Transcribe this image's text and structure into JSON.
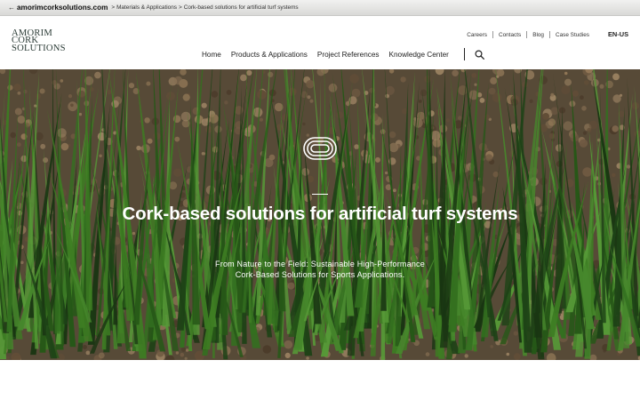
{
  "breadcrumb": {
    "back_glyph": "←",
    "domain": "amorimcorksolutions.com",
    "separator": ">",
    "items": [
      "Materials & Applications",
      "Cork-based solutions for artificial turf systems"
    ]
  },
  "logo": {
    "lines": [
      "AMORIM",
      "CORK",
      "SOLUTIONS"
    ]
  },
  "top_nav": [
    "Careers",
    "Contacts",
    "Blog",
    "Case Studies"
  ],
  "language": "EN-US",
  "main_nav": [
    "Home",
    "Products & Applications",
    "Project References",
    "Knowledge Center"
  ],
  "hero": {
    "icon": "running-track-icon",
    "title": "Cork-based solutions for artificial turf systems",
    "subtitle_line1": "From Nature to the Field: Sustainable High-Performance",
    "subtitle_line2": "Cork-Based Solutions for Sports Applications."
  },
  "colors": {
    "logo": "#2b3b36",
    "text": "#222222",
    "hero_text": "#ffffff"
  }
}
